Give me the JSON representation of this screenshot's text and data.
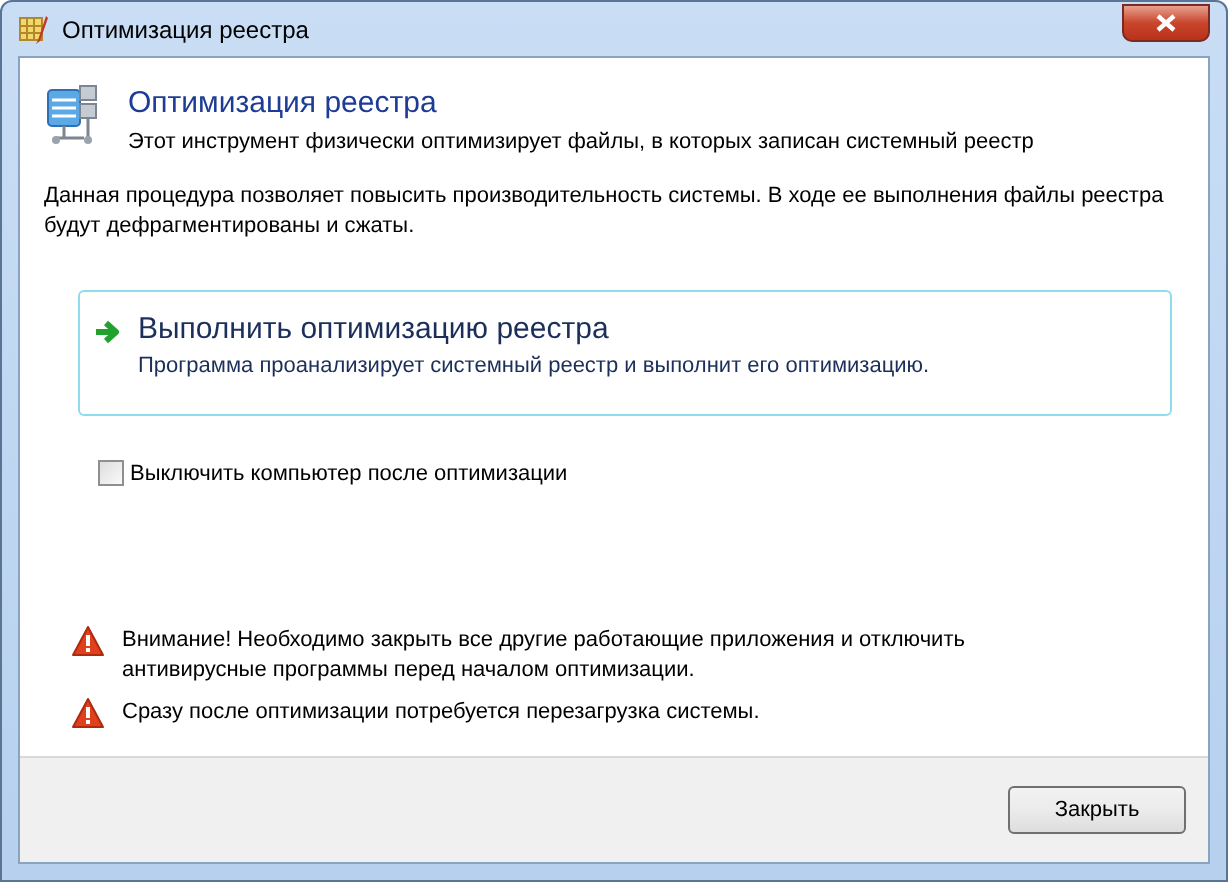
{
  "window": {
    "title": "Оптимизация реестра"
  },
  "header": {
    "title": "Оптимизация реестра",
    "subtitle": "Этот инструмент физически оптимизирует файлы, в которых записан системный реестр"
  },
  "description": "Данная процедура позволяет повысить производительность системы. В ходе ее выполнения файлы реестра будут дефрагментированы и сжаты.",
  "action": {
    "title": "Выполнить оптимизацию реестра",
    "subtitle": "Программа проанализирует системный реестр и выполнит его оптимизацию."
  },
  "shutdown_option": {
    "label": "Выключить компьютер после оптимизации",
    "checked": false
  },
  "warnings": [
    "Внимание! Необходимо закрыть все другие работающие приложения и отключить антивирусные программы перед началом оптимизации.",
    "Сразу после оптимизации потребуется перезагрузка системы."
  ],
  "buttons": [
    "Закрыть"
  ]
}
